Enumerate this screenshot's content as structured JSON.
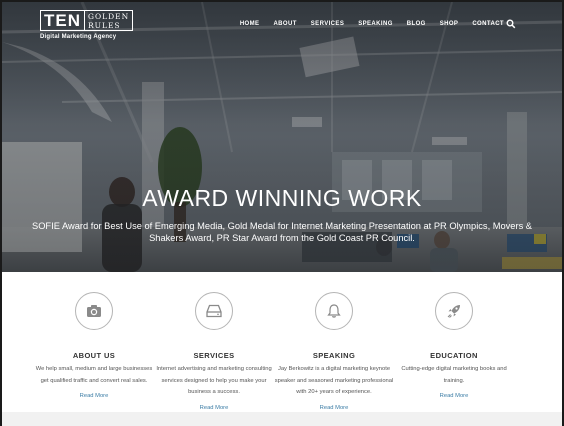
{
  "logo": {
    "ten": "TEN",
    "golden": "GOLDEN",
    "rules": "RULES",
    "tagline": "Digital Marketing Agency"
  },
  "nav": {
    "items": [
      "HOME",
      "ABOUT",
      "SERVICES",
      "SPEAKING",
      "BLOG",
      "SHOP",
      "CONTACT"
    ],
    "search_icon": "search-icon"
  },
  "hero": {
    "title": "AWARD WINNING WORK",
    "subtitle": "SOFIE Award for Best Use of Emerging Media, Gold Medal for Internet Marketing Presentation at PR Olympics, Movers & Shakers Award, PR Star Award from the Gold Coast PR Council."
  },
  "features": [
    {
      "icon": "camera-icon",
      "title": "ABOUT US",
      "desc": "We help small, medium and large businesses get qualified traffic and convert real sales.",
      "link": "Read More"
    },
    {
      "icon": "drive-icon",
      "title": "SERVICES",
      "desc": "Internet advertising and marketing consulting services designed to help you make your business a success.",
      "link": "Read More"
    },
    {
      "icon": "bell-icon",
      "title": "SPEAKING",
      "desc": "Jay Berkowitz is a digital marketing keynote speaker and seasoned marketing professional with 20+ years of experience.",
      "link": "Read More"
    },
    {
      "icon": "rocket-icon",
      "title": "EDUCATION",
      "desc": "Cutting-edge digital marketing books and training.",
      "link": "Read More"
    }
  ],
  "colors": {
    "link": "#3a7ca5",
    "text": "#333333",
    "icon_border": "#b5b5b5"
  }
}
